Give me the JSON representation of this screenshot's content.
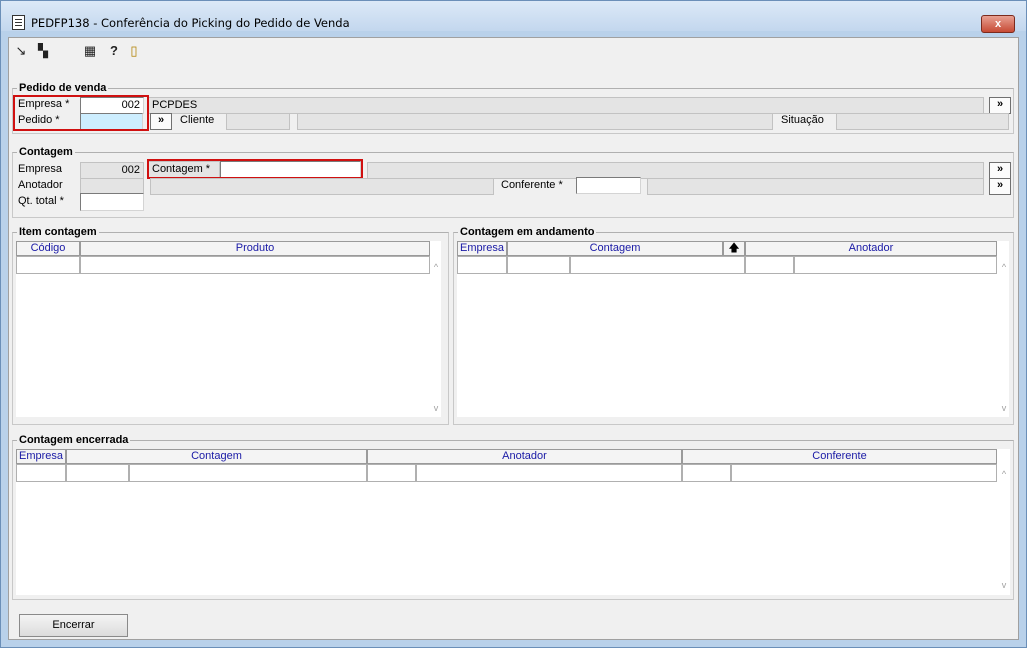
{
  "window": {
    "title": "PEDFP138 - Conferência do Picking do Pedido de Venda",
    "close_label": "x"
  },
  "toolbar": {
    "icons": [
      "export-icon",
      "copy-icon",
      "calendar-grid-icon",
      "help-icon",
      "exit-door-icon"
    ],
    "glyphs": [
      "↘",
      "▚",
      "▦",
      "?",
      "▯"
    ]
  },
  "pedido_venda": {
    "title": "Pedido de venda",
    "empresa_label": "Empresa *",
    "empresa_value": "002",
    "empresa_name": "PCPDES",
    "pedido_label": "Pedido *",
    "pedido_value": "",
    "more_label": "»",
    "cliente_label": "Cliente",
    "situacao_label": "Situação"
  },
  "contagem": {
    "title": "Contagem",
    "empresa_label": "Empresa",
    "empresa_value": "002",
    "contagem_label": "Contagem *",
    "anotador_label": "Anotador",
    "conferente_label": "Conferente *",
    "qt_total_label": "Qt. total *",
    "more_label": "»"
  },
  "item_contagem": {
    "title": "Item contagem",
    "columns": [
      "Código",
      "Produto"
    ]
  },
  "contagem_andamento": {
    "title": "Contagem em andamento",
    "columns": [
      "Empresa",
      "Contagem",
      "Anotador"
    ],
    "sort_indicator": "🡅"
  },
  "contagem_encerrada": {
    "title": "Contagem encerrada",
    "columns": [
      "Empresa",
      "Contagem",
      "Anotador",
      "Conferente"
    ]
  },
  "footer": {
    "encerrar_label": "Encerrar"
  },
  "colors": {
    "highlight_border": "#d01010",
    "focused_field": "#cdeeff",
    "header_text": "#1a1aa6"
  }
}
